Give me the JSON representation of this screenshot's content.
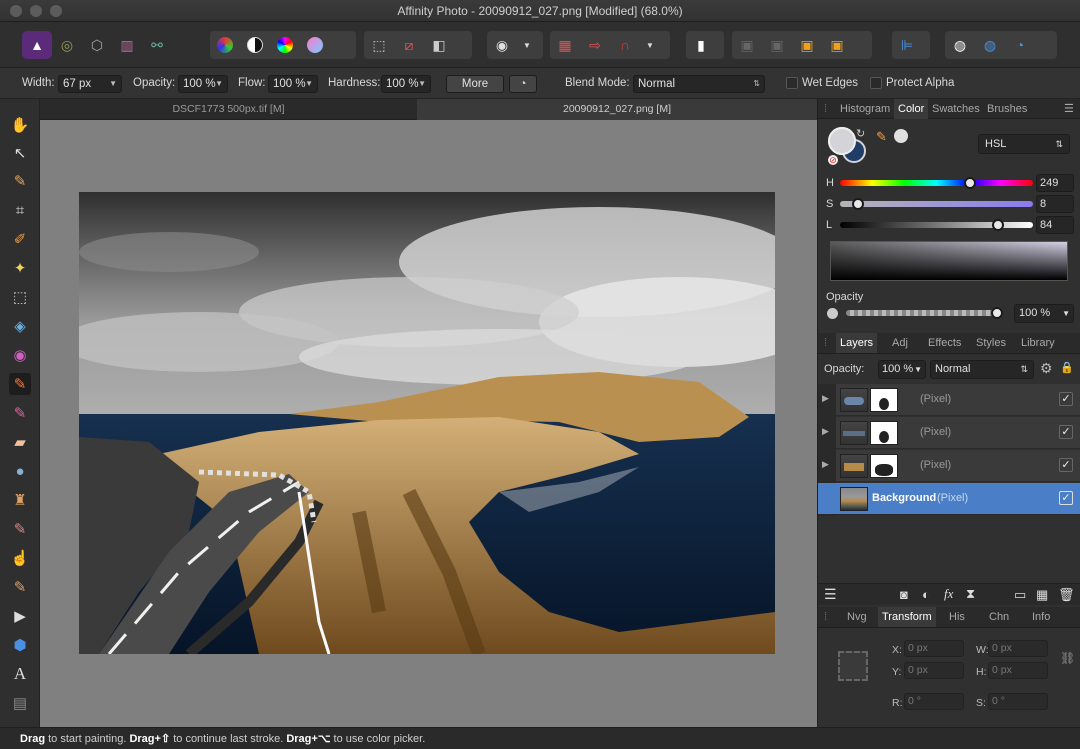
{
  "window": {
    "title": "Affinity Photo - 20090912_027.png [Modified] (68.0%)"
  },
  "personas": [
    "photo-persona-icon",
    "liquify-persona-icon",
    "develop-persona-icon",
    "tone-mapping-persona-icon",
    "export-persona-icon"
  ],
  "context_bar": {
    "width_label": "Width:",
    "width_value": "67 px",
    "opacity_label": "Opacity:",
    "opacity_value": "100 %",
    "flow_label": "Flow:",
    "flow_value": "100 %",
    "hardness_label": "Hardness:",
    "hardness_value": "100 %",
    "more_label": "More",
    "blend_label": "Blend Mode:",
    "blend_value": "Normal",
    "wet_edges_label": "Wet Edges",
    "protect_alpha_label": "Protect Alpha"
  },
  "doc_tabs": [
    {
      "label": "DSCF1773 500px.tif [M]",
      "active": false
    },
    {
      "label": "20090912_027.png [M]",
      "active": true
    }
  ],
  "top_panel": {
    "tabs": [
      "Histogram",
      "Color",
      "Swatches",
      "Brushes"
    ],
    "active_tab": "Color",
    "color_model": "HSL",
    "h_label": "H",
    "h_value": "249",
    "s_label": "S",
    "s_value": "8",
    "l_label": "L",
    "l_value": "84",
    "opacity_label": "Opacity",
    "opacity_value": "100 %"
  },
  "layers_panel": {
    "tabs": [
      "Layers",
      "Adj",
      "Effects",
      "Styles",
      "Library"
    ],
    "active_tab": "Layers",
    "opacity_label": "Opacity:",
    "opacity_value": "100 %",
    "blend_value": "Normal",
    "layers": [
      {
        "name": "",
        "type": "(Pixel)",
        "selected": false
      },
      {
        "name": "",
        "type": "(Pixel)",
        "selected": false
      },
      {
        "name": "",
        "type": "(Pixel)",
        "selected": false
      },
      {
        "name": "Background",
        "type": "(Pixel)",
        "selected": true
      }
    ]
  },
  "bottom_panel": {
    "tabs": [
      "Nvg",
      "Transform",
      "His",
      "Chn",
      "Info"
    ],
    "active_tab": "Transform",
    "x_label": "X:",
    "x_value": "0 px",
    "y_label": "Y:",
    "y_value": "0 px",
    "w_label": "W:",
    "w_value": "0 px",
    "h_label": "H:",
    "h_value": "0 px",
    "r_label": "R:",
    "r_value": "0 °",
    "s_label": "S:",
    "s_value": "0 °"
  },
  "status_bar": {
    "b1": "Drag",
    "t1": " to start painting. ",
    "b2": "Drag+⇧",
    "t2": " to continue last stroke. ",
    "b3": "Drag+⌥",
    "t3": " to use color picker."
  },
  "colors": {
    "accent": "#4a7fc7",
    "sepia": "#b58a4a",
    "sea": "#0f2b4a"
  }
}
